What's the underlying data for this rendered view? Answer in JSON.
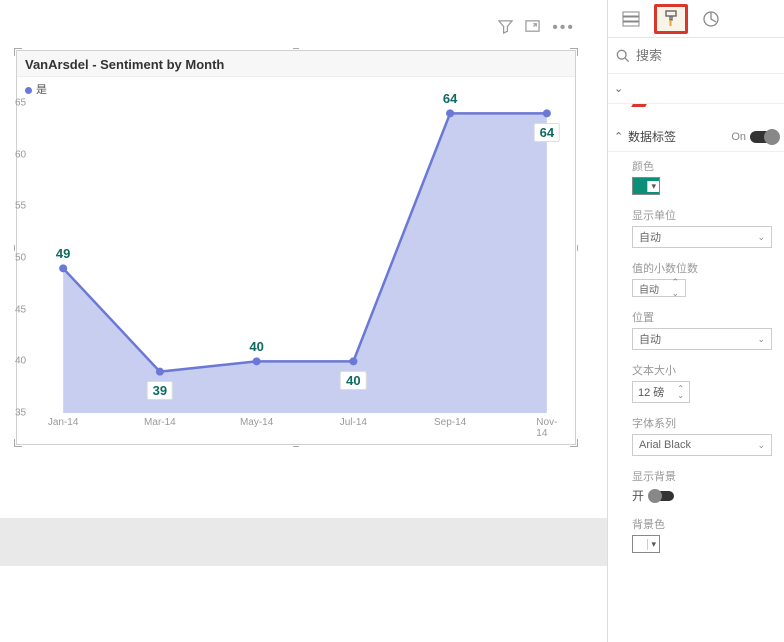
{
  "chart_data": {
    "type": "area",
    "title": "VanArsdel - Sentiment by Month",
    "legend": "是",
    "categories": [
      "Jan-14",
      "Mar-14",
      "May-14",
      "Jul-14",
      "Sep-14",
      "Nov-14"
    ],
    "values": [
      49,
      39,
      40,
      40,
      64,
      64
    ],
    "ylim": [
      35,
      65
    ],
    "yticks": [
      35,
      40,
      45,
      50,
      55,
      60,
      65
    ],
    "label_placements": [
      "above",
      "below",
      "above",
      "below",
      "above",
      "below"
    ],
    "series_color": "#6b78d6",
    "fill_color": "#b6bdea"
  },
  "toolbar": {
    "filter_icon": "filter-icon",
    "focus_icon": "focus-icon",
    "more_icon": "more-icon"
  },
  "panel": {
    "search_placeholder": "搜索",
    "collapsed_section": "",
    "data_labels": {
      "title": "数据标签",
      "on": "On"
    },
    "props": {
      "color_label": "颜色",
      "display_unit_label": "显示单位",
      "display_unit_value": "自动",
      "decimals_label": "值的小数位数",
      "decimals_value": "自动",
      "position_label": "位置",
      "position_value": "自动",
      "font_size_label": "文本大小",
      "font_size_value": "12 磅",
      "font_family_label": "字体系列",
      "font_family_value": "Arial Black",
      "show_bg_label": "显示背景",
      "show_bg_on": "开",
      "bg_color_label": "背景色"
    }
  }
}
